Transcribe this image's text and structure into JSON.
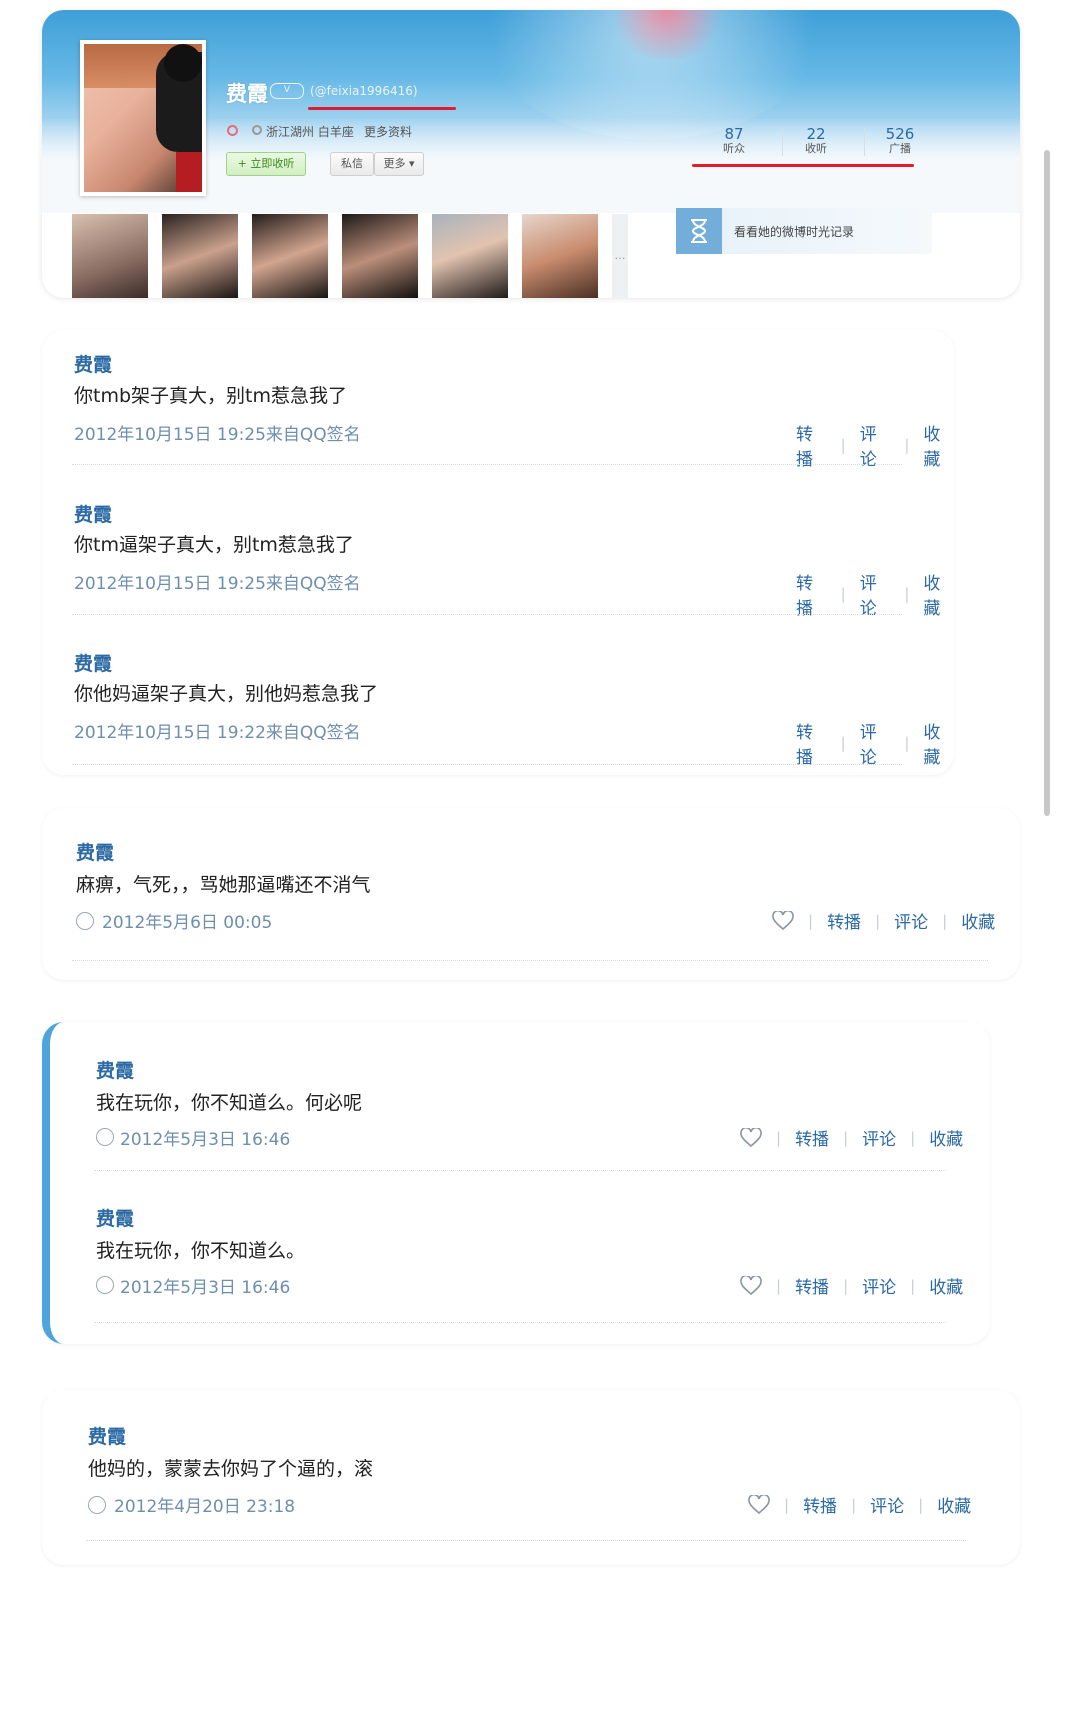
{
  "profile": {
    "name": "费霞",
    "handle": "(@feixia1996416)",
    "location": "浙江湖州 白羊座",
    "more_info": "更多资料",
    "follow_button": "+ 立即收听",
    "message_button": "私信",
    "more_button": "更多 ▾",
    "stats": [
      {
        "value": "87",
        "label": "听众"
      },
      {
        "value": "22",
        "label": "收听"
      },
      {
        "value": "526",
        "label": "广播"
      }
    ],
    "thumbnail_more": "…",
    "timeline_label": "看看她的微博时光记录",
    "colors": {
      "accent": "#2c6aa5",
      "highlight": "#e01c2e"
    }
  },
  "actions": {
    "repost": "转播",
    "comment": "评论",
    "favorite": "收藏",
    "separator": "|"
  },
  "posts": [
    {
      "author": "费霞",
      "content": "你tmb架子真大，别tm惹急我了",
      "meta": "2012年10月15日 19:25来自QQ签名"
    },
    {
      "author": "费霞",
      "content": "你tm逼架子真大，别tm惹急我了",
      "meta": "2012年10月15日 19:25来自QQ签名"
    },
    {
      "author": "费霞",
      "content": "你他妈逼架子真大，别他妈惹急我了",
      "meta": "2012年10月15日 19:22来自QQ签名"
    },
    {
      "author": "费霞",
      "content": "麻痹，气死，，骂她那逼嘴还不消气",
      "meta": "2012年5月6日 00:05"
    },
    {
      "author": "费霞",
      "content": "我在玩你，你不知道么。何必呢",
      "meta": "2012年5月3日 16:46"
    },
    {
      "author": "费霞",
      "content": "我在玩你，你不知道么。",
      "meta": "2012年5月3日 16:46"
    },
    {
      "author": "费霞",
      "content": "他妈的，蒙蒙去你妈了个逼的，滚",
      "meta": "2012年4月20日 23:18"
    }
  ]
}
